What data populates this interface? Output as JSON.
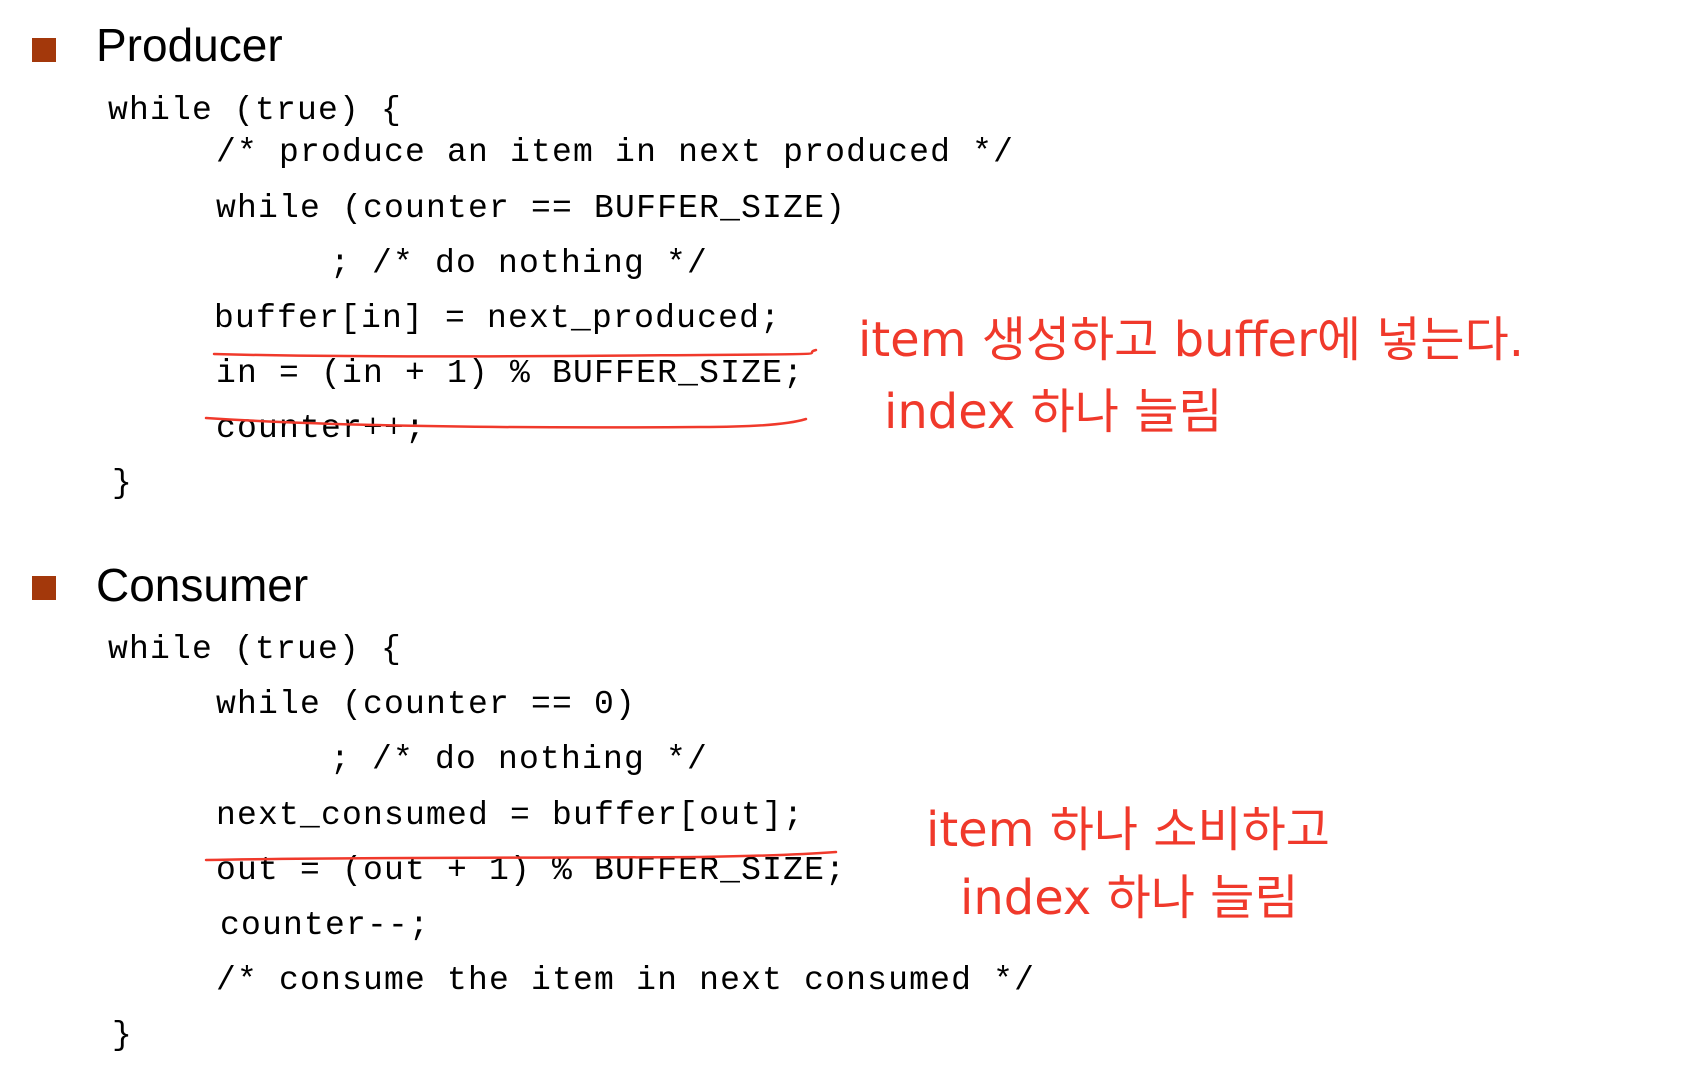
{
  "accent_color": "#a3380b",
  "annotation_color": "#f0392b",
  "bullet_icon": "square-bullet-icon",
  "producer": {
    "heading": "Producer",
    "code": [
      "while (true) {",
      "/* produce an item in next produced */",
      "while (counter == BUFFER_SIZE)",
      "; /* do nothing */",
      "buffer[in] = next_produced;",
      "in = (in + 1) % BUFFER_SIZE;",
      "counter++;",
      "}"
    ],
    "annotations": [
      "item 생성하고 buffer에 넣는다.",
      "index 하나 늘림"
    ]
  },
  "consumer": {
    "heading": "Consumer",
    "code": [
      "while (true) {",
      "while (counter == 0)",
      "; /* do nothing */",
      "next_consumed = buffer[out];",
      "out = (out + 1) % BUFFER_SIZE;",
      "counter--;",
      "/* consume the item in next consumed */",
      "}"
    ],
    "annotations": [
      "item 하나 소비하고",
      "index 하나 늘림"
    ]
  }
}
